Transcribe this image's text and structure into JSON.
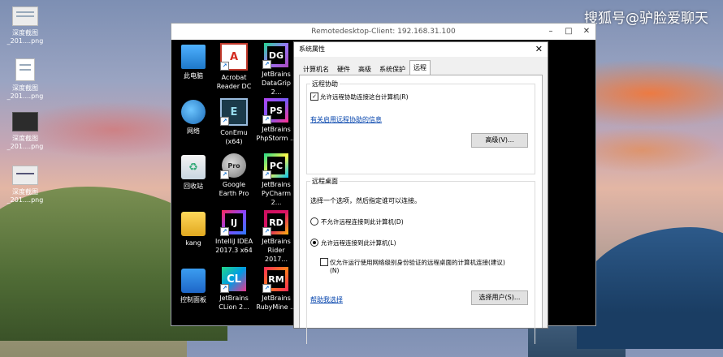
{
  "watermark": "搜狐号@驴脸爱聊天",
  "local_desktop": {
    "icons": [
      {
        "label_line1": "深度截图",
        "label_line2": "_201....png"
      },
      {
        "label_line1": "深度截图",
        "label_line2": "_201....png"
      },
      {
        "label_line1": "深度截图",
        "label_line2": "_201....png"
      },
      {
        "label_line1": "深度截图",
        "label_line2": "_201....png"
      }
    ]
  },
  "rdp_window": {
    "title": "Remotedesktop-Client: 192.168.31.100",
    "minimize": "–",
    "maximize": "□",
    "close": "✕"
  },
  "remote_desktop": {
    "icons": [
      {
        "line1": "此电脑",
        "line2": "",
        "glyph": ""
      },
      {
        "line1": "Acrobat",
        "line2": "Reader DC",
        "glyph": "A"
      },
      {
        "line1": "JetBrains",
        "line2": "DataGrip 2...",
        "glyph": "DG"
      },
      {
        "line1": "网络",
        "line2": "",
        "glyph": ""
      },
      {
        "line1": "ConEmu",
        "line2": "(x64)",
        "glyph": "E"
      },
      {
        "line1": "JetBrains",
        "line2": "PhpStorm ...",
        "glyph": "PS"
      },
      {
        "line1": "回收站",
        "line2": "",
        "glyph": "♻"
      },
      {
        "line1": "Google",
        "line2": "Earth Pro",
        "glyph": "Pro"
      },
      {
        "line1": "JetBrains",
        "line2": "PyCharm 2...",
        "glyph": "PC"
      },
      {
        "line1": "kang",
        "line2": "",
        "glyph": ""
      },
      {
        "line1": "IntelliJ IDEA",
        "line2": "2017.3 x64",
        "glyph": "IJ"
      },
      {
        "line1": "JetBrains",
        "line2": "Rider 2017...",
        "glyph": "RD"
      },
      {
        "line1": "控制面板",
        "line2": "",
        "glyph": ""
      },
      {
        "line1": "JetBrains",
        "line2": "CLion 2...",
        "glyph": "CL"
      },
      {
        "line1": "JetBrains",
        "line2": "RubyMine ...",
        "glyph": "RM"
      }
    ]
  },
  "dialog": {
    "title": "系统属性",
    "close": "✕",
    "tabs": [
      "计算机名",
      "硬件",
      "高级",
      "系统保护",
      "远程"
    ],
    "active_tab": "远程",
    "remote_assist": {
      "group_title": "远程协助",
      "allow_checkbox_label": "允许远程协助连接这台计算机(R)",
      "allow_checked": true,
      "link": "有关启用远程协助的信息",
      "advanced_button": "高级(V)..."
    },
    "remote_desktop": {
      "group_title": "远程桌面",
      "instruction": "选择一个选项，然后指定谁可以连接。",
      "option_deny": "不允许远程连接到此计算机(D)",
      "option_allow": "允许远程连接到此计算机(L)",
      "selected": "allow",
      "nla_label_line1": "仅允许运行使用网络级别身份验证的远程桌面的计算机连接(建议)",
      "nla_label_line2": "(N)",
      "nla_checked": false,
      "help_link": "帮助我选择",
      "select_users_button": "选择用户(S)..."
    }
  }
}
